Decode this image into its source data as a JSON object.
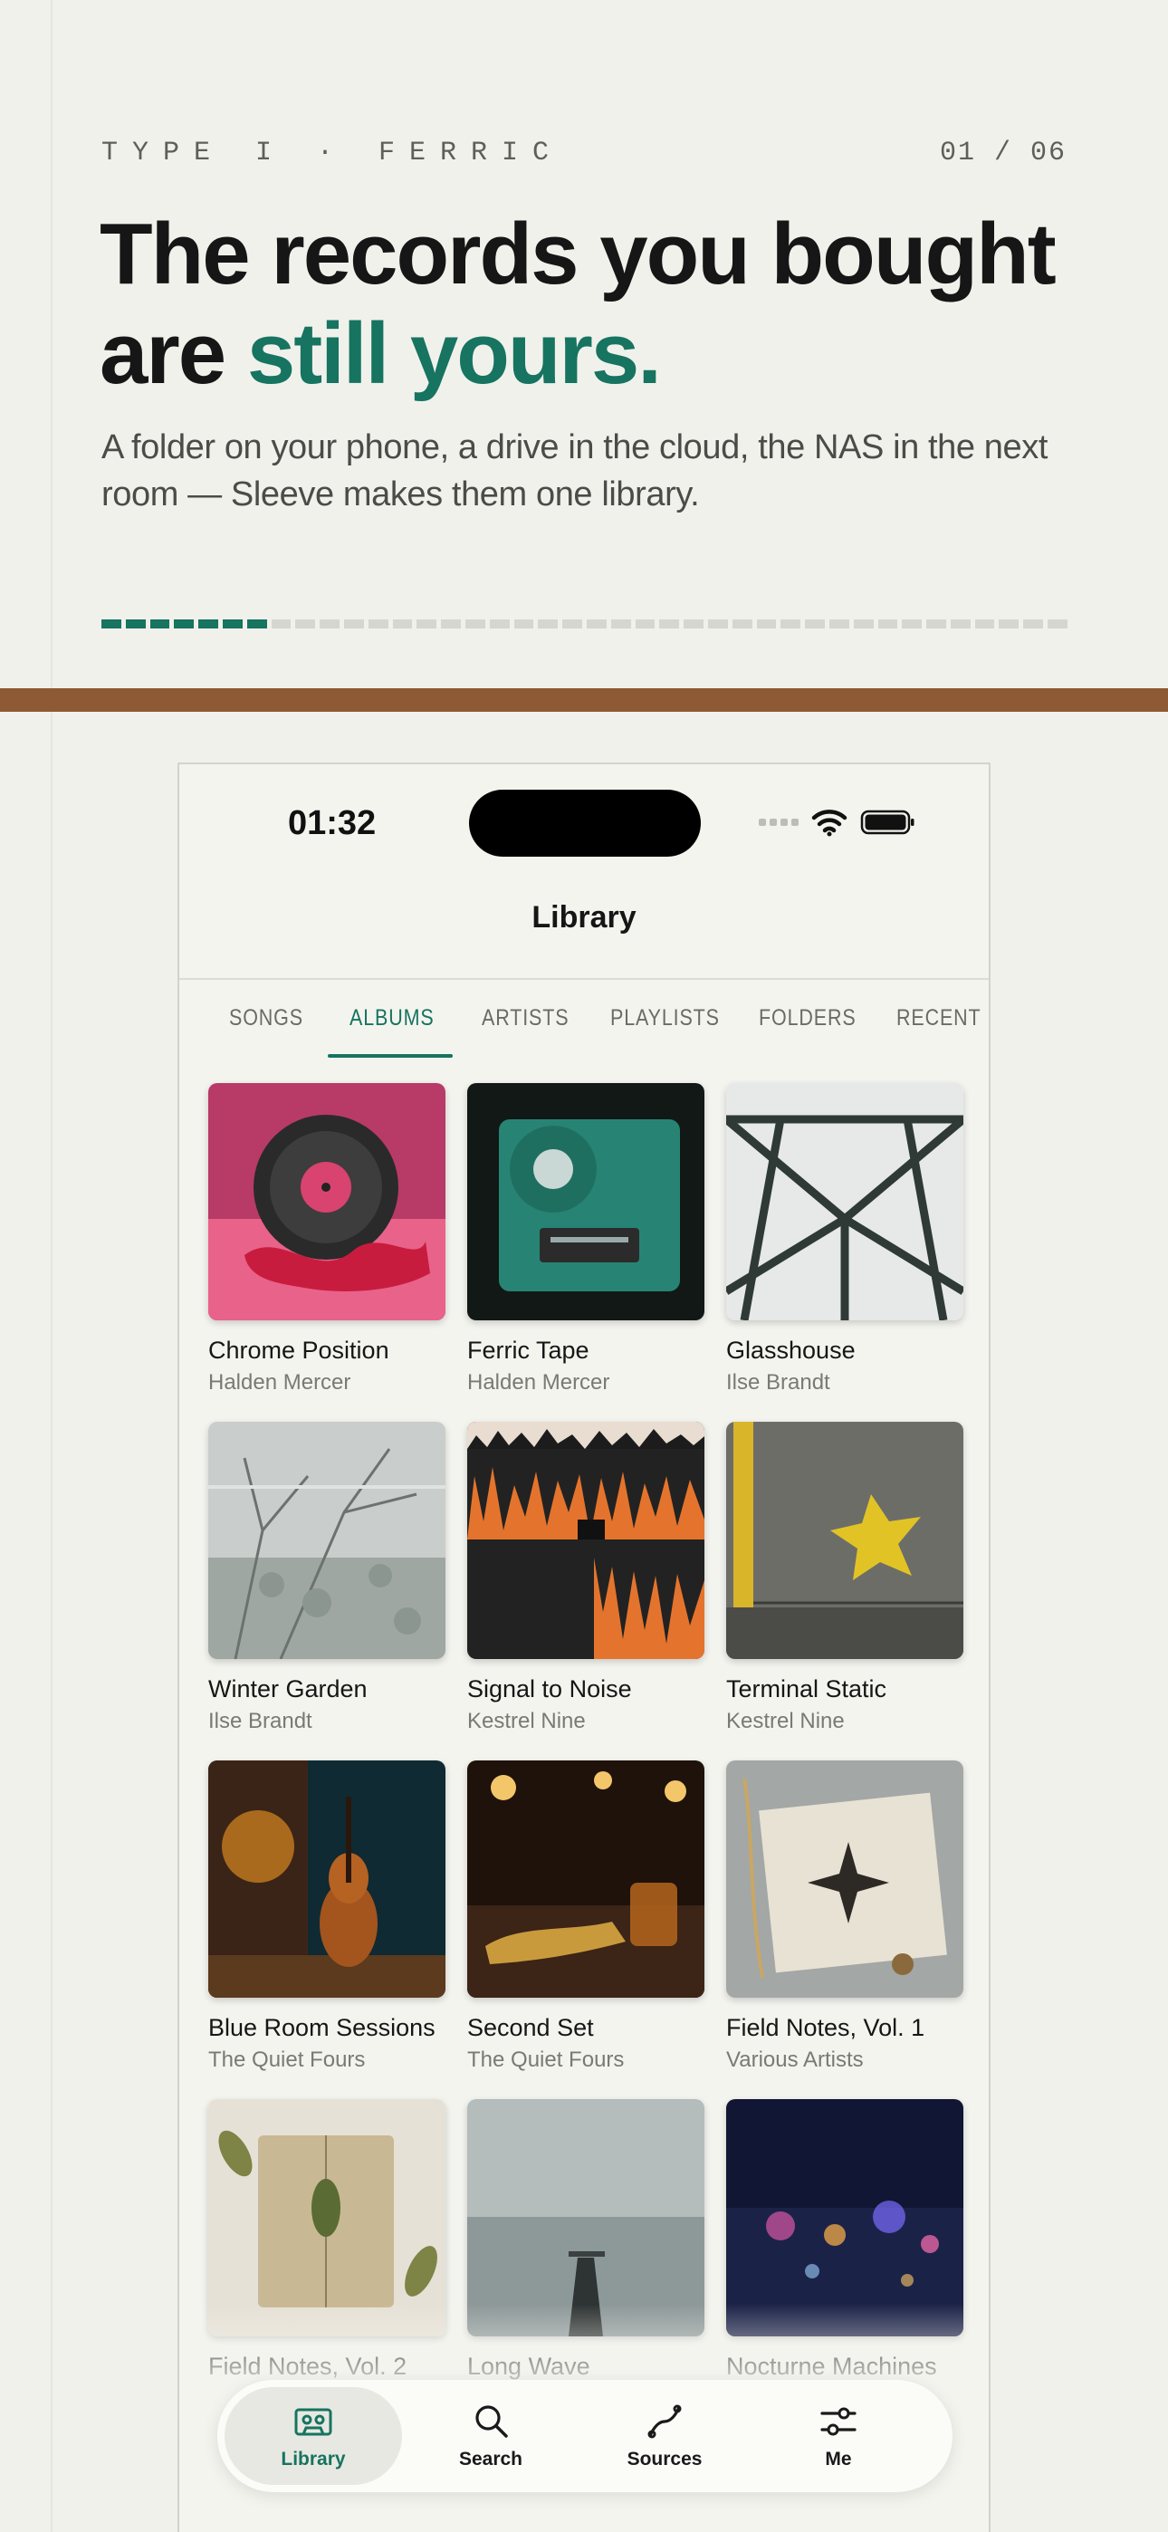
{
  "hero": {
    "kicker": "TYPE I · FERRIC",
    "pager": "01 / 06",
    "headline_line1": "The records you bought",
    "headline_are": "are ",
    "headline_accent": "still yours.",
    "lede": "A folder on your phone, a drive in the cloud, the NAS in the next room — Sleeve makes them one library.",
    "progress": {
      "segments_total": 40,
      "segments_filled": 7
    }
  },
  "colors": {
    "accent": "#167460",
    "band": "#8e5a33",
    "background": "#f1f1ec"
  },
  "status_bar": {
    "time": "01:32",
    "icons": [
      "signal-icon",
      "wifi-icon",
      "battery-icon"
    ]
  },
  "nav": {
    "title": "Library"
  },
  "tabs": [
    {
      "label": "SONGS",
      "active": false
    },
    {
      "label": "ALBUMS",
      "active": true
    },
    {
      "label": "ARTISTS",
      "active": false
    },
    {
      "label": "PLAYLISTS",
      "active": false
    },
    {
      "label": "FOLDERS",
      "active": false
    },
    {
      "label": "RECENT",
      "active": false
    }
  ],
  "albums": [
    {
      "title": "Chrome Position",
      "artist": "Halden Mercer",
      "art": "pink vinyl record with red ribbon"
    },
    {
      "title": "Ferric Tape",
      "artist": "Halden Mercer",
      "art": "translucent green cassette tape"
    },
    {
      "title": "Glasshouse",
      "artist": "Ilse Brandt",
      "art": "steel glasshouse roof"
    },
    {
      "title": "Winter Garden",
      "artist": "Ilse Brandt",
      "art": "frosted winter branches"
    },
    {
      "title": "Signal to Noise",
      "artist": "Kestrel Nine",
      "art": "orange waveform"
    },
    {
      "title": "Terminal Static",
      "artist": "Kestrel Nine",
      "art": "cracked concrete with yellow paint"
    },
    {
      "title": "Blue Room Sessions",
      "artist": "The Quiet Fours",
      "art": "cello in a blue room"
    },
    {
      "title": "Second Set",
      "artist": "The Quiet Fours",
      "art": "trumpet and whiskey at a bar"
    },
    {
      "title": "Field Notes, Vol. 1",
      "artist": "Various Artists",
      "art": "compass map with wheat"
    },
    {
      "title": "Field Notes, Vol. 2",
      "artist": "",
      "art": "notebook with leaves"
    },
    {
      "title": "Long Wave",
      "artist": "",
      "art": "pier in fog"
    },
    {
      "title": "Nocturne Machines",
      "artist": "",
      "art": "city lights bokeh"
    }
  ],
  "tabbar": [
    {
      "label": "Library",
      "icon": "cassette-icon",
      "active": true
    },
    {
      "label": "Search",
      "icon": "search-icon",
      "active": false
    },
    {
      "label": "Sources",
      "icon": "link-icon",
      "active": false
    },
    {
      "label": "Me",
      "icon": "sliders-icon",
      "active": false
    }
  ]
}
